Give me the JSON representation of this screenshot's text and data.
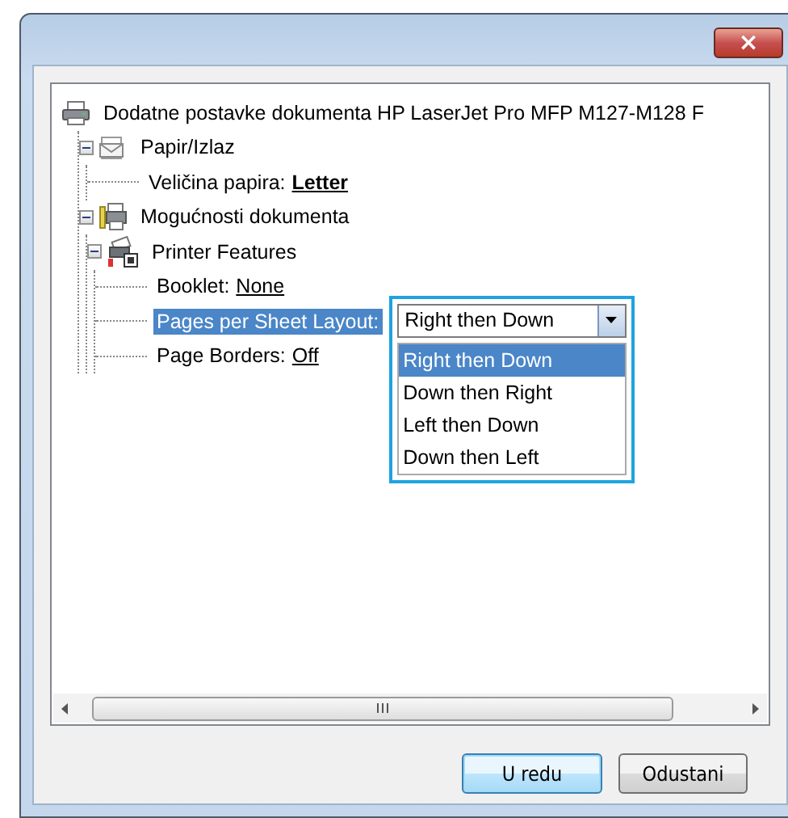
{
  "window": {
    "close_button": "×"
  },
  "tree": {
    "root": {
      "kind": "printer",
      "label": "Dodatne postavke dokumenta HP LaserJet Pro MFP M127-M128 F",
      "children": [
        {
          "kind": "paper",
          "label": "Papir/Izlaz",
          "expanded": true,
          "children": [
            {
              "kind": "setting",
              "label": "Veličina papira:",
              "value": "Letter",
              "value_bold": true,
              "selected": false
            }
          ]
        },
        {
          "kind": "features",
          "label": "Mogućnosti dokumenta",
          "expanded": true,
          "children": [
            {
              "kind": "options",
              "label": "Printer Features",
              "expanded": true,
              "children": [
                {
                  "kind": "setting",
                  "label": "Booklet:",
                  "value": "None",
                  "value_bold": false,
                  "selected": false
                },
                {
                  "kind": "setting",
                  "label": "Pages per Sheet Layout:",
                  "selected": true,
                  "dropdown": {
                    "value": "Right then Down",
                    "options": [
                      {
                        "label": "Right then Down",
                        "selected": true
                      },
                      {
                        "label": "Down then Right",
                        "selected": false
                      },
                      {
                        "label": "Left then Down",
                        "selected": false
                      },
                      {
                        "label": "Down then Left",
                        "selected": false
                      }
                    ]
                  }
                },
                {
                  "kind": "setting",
                  "label": "Page Borders:",
                  "value": "Off",
                  "value_bold": false,
                  "selected": false
                }
              ]
            }
          ]
        }
      ]
    }
  },
  "buttons": [
    {
      "label": "U redu",
      "default": true
    },
    {
      "label": "Odustani",
      "default": false
    }
  ]
}
